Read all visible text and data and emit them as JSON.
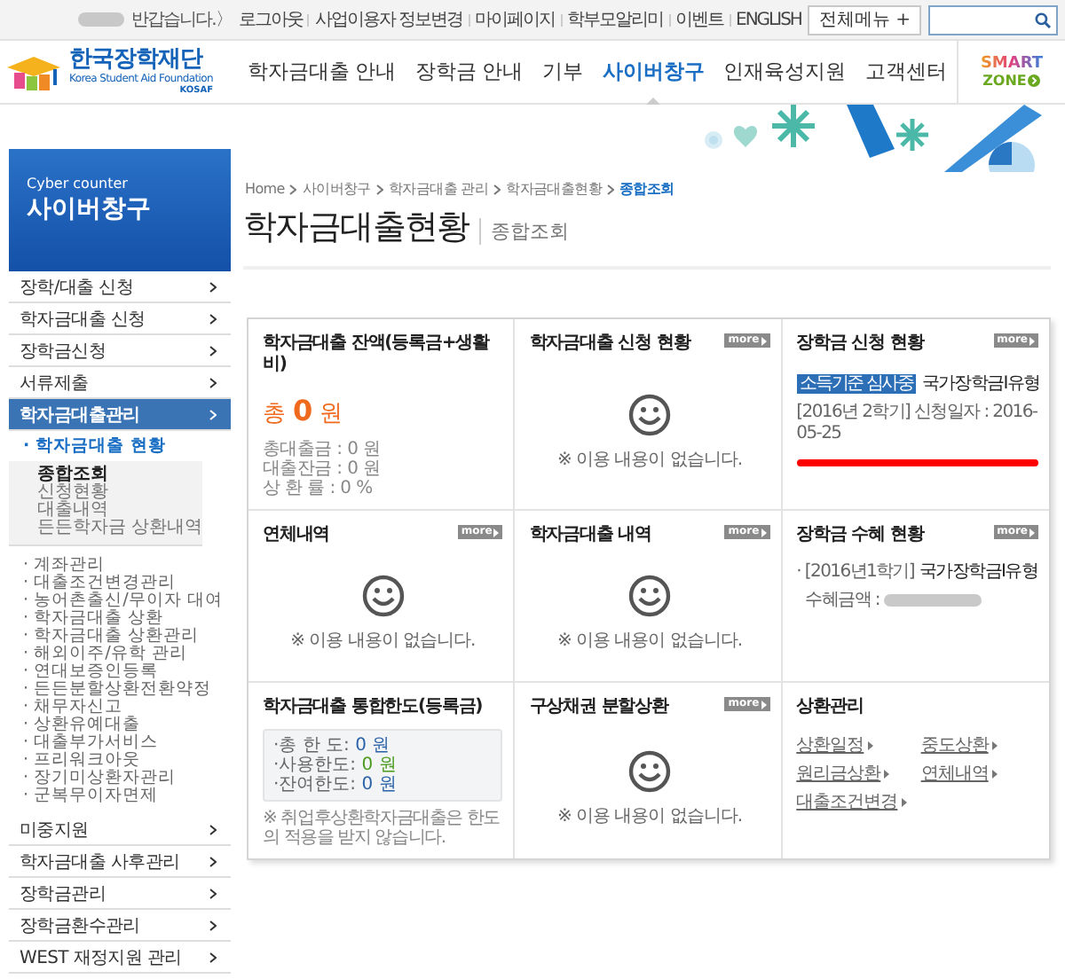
{
  "top_bar": {
    "greeting": "반갑습니다.〉",
    "links": [
      "로그아웃",
      "사업이용자 정보변경",
      "마이페이지",
      "학부모알리미",
      "이벤트",
      "ENGLISH"
    ],
    "all_menu_button": "전체메뉴 +"
  },
  "logo": {
    "name": "한국장학재단",
    "subtitle": "Korea Student Aid Foundation",
    "abbr": "KOSAF"
  },
  "nav": [
    {
      "label": "학자금대출 안내",
      "selected": false
    },
    {
      "label": "장학금 안내",
      "selected": false
    },
    {
      "label": "기부",
      "selected": false
    },
    {
      "label": "사이버창구",
      "selected": true
    },
    {
      "label": "인재육성지원",
      "selected": false
    },
    {
      "label": "고객센터",
      "selected": false
    }
  ],
  "smart_zone": {
    "line1": "SMART",
    "line2": "ZONE"
  },
  "sidebar": {
    "caption": "Cyber counter",
    "title": "사이버창구",
    "items": [
      {
        "label": "장학/대출 신청",
        "selected": false
      },
      {
        "label": "학자금대출 신청",
        "selected": false
      },
      {
        "label": "장학금신청",
        "selected": false
      },
      {
        "label": "서류제출",
        "selected": false
      },
      {
        "label": "학자금대출관리",
        "selected": true,
        "children": [
          {
            "label": "· 학자금대출 현황",
            "selected": true,
            "children": [
              {
                "label": "종합조회",
                "selected": true
              },
              {
                "label": "신청현황",
                "selected": false
              },
              {
                "label": "대출내역",
                "selected": false
              },
              {
                "label": "든든학자금 상환내역",
                "selected": false
              }
            ]
          },
          {
            "label": "· 계좌관리",
            "selected": false
          },
          {
            "label": "· 대출조건변경관리",
            "selected": false
          },
          {
            "label": "· 농어촌출신/무이자 대여",
            "selected": false
          },
          {
            "label": "· 학자금대출 상환",
            "selected": false
          },
          {
            "label": "· 학자금대출 상환관리",
            "selected": false
          },
          {
            "label": "· 해외이주/유학 관리",
            "selected": false
          },
          {
            "label": "· 연대보증인등록",
            "selected": false
          },
          {
            "label": "· 든든분할상환전환약정",
            "selected": false
          },
          {
            "label": "· 채무자신고",
            "selected": false
          },
          {
            "label": "· 상환유예대출",
            "selected": false
          },
          {
            "label": "· 대출부가서비스",
            "selected": false
          },
          {
            "label": "· 프리워크아웃",
            "selected": false
          },
          {
            "label": "· 장기미상환자관리",
            "selected": false
          },
          {
            "label": "· 군복무이자면제",
            "selected": false
          }
        ]
      },
      {
        "label": "미중지원",
        "selected": false
      },
      {
        "label": "학자금대출 사후관리",
        "selected": false
      },
      {
        "label": "장학금관리",
        "selected": false
      },
      {
        "label": "장학금환수관리",
        "selected": false
      },
      {
        "label": "WEST 재정지원 관리",
        "selected": false
      }
    ]
  },
  "breadcrumb": [
    {
      "label": "Home",
      "selected": false
    },
    {
      "label": "사이버창구",
      "selected": false
    },
    {
      "label": "학자금대출 관리",
      "selected": false
    },
    {
      "label": "학자금대출현황",
      "selected": false
    },
    {
      "label": "종합조회",
      "selected": true
    }
  ],
  "page_title": "학자금대출현황",
  "page_subtitle": "종합조회",
  "cards": [
    {
      "kind": "balance",
      "title": "학자금대출 잔액(등록금+생활비)",
      "total_prefix": "총",
      "total": "0",
      "total_unit": "원",
      "lines": [
        "총대출금 : 0 원",
        "대출잔금 : 0 원",
        "상 환 률 : 0 %"
      ]
    },
    {
      "kind": "empty",
      "title": "학자금대출 신청 현황",
      "more": "more",
      "message": "※ 이용 내용이 없습니다."
    },
    {
      "kind": "application",
      "title": "장학금 신청 현황",
      "more": "more",
      "tag": "소득기준 심사중",
      "name": "국가장학금I유형",
      "detail": "[2016년 2학기] 신청일자 : 2016-05-25",
      "underline_mark": true
    },
    {
      "kind": "empty",
      "title": "연체내역",
      "more": "more",
      "message": "※ 이용 내용이 없습니다."
    },
    {
      "kind": "empty",
      "title": "학자금대출 내역",
      "more": "more",
      "message": "※ 이용 내용이 없습니다."
    },
    {
      "kind": "receipt",
      "title": "장학금 수혜 현황",
      "more": "more",
      "term": "· [2016년1학기]",
      "name": "국가장학금I유형",
      "amount_label": "수혜금액 :"
    },
    {
      "kind": "limit",
      "title": "학자금대출 통합한도(등록금)",
      "rows": [
        {
          "label": "·총 한 도:",
          "value": "0 원",
          "color": "#2a62a8"
        },
        {
          "label": "·사용한도:",
          "value": "0 원",
          "color": "#4a9a1e"
        },
        {
          "label": "·잔여한도:",
          "value": "0 원",
          "color": "#2a62a8"
        }
      ],
      "note": "※ 취업후상환학자금대출은 한도의 적용을 받지 않습니다."
    },
    {
      "kind": "empty",
      "title": "구상채권 분할상환",
      "more": "more",
      "message": "※ 이용 내용이 없습니다."
    },
    {
      "kind": "links",
      "title": "상환관리",
      "links": [
        "상환일정",
        "중도상환",
        "원리금상환",
        "연체내역",
        "대출조건변경"
      ]
    }
  ]
}
